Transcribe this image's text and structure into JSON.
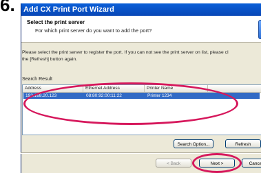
{
  "step_number": "6.",
  "window": {
    "title": "Add CX Print Port Wizard"
  },
  "header": {
    "title": "Select the print server",
    "subtitle": "For which print server do you want to add the port?"
  },
  "instruction": {
    "line1": "Please select the print server to register the port. If you can not see the print server on list, please cl",
    "line2": "the [Refresh] button again."
  },
  "search_result": {
    "label": "Search Result",
    "columns": [
      "Address",
      "Ethernet Address",
      "Printer Name"
    ],
    "rows": [
      {
        "address": "192.168.20.123",
        "ethernet": "08:80:92:00:11:22",
        "printer": "Printer 1234"
      }
    ]
  },
  "buttons": {
    "search_option": "Search Option...",
    "refresh": "Refresh",
    "back": "< Back",
    "next": "Next >",
    "cancel": "Cance"
  },
  "colors": {
    "title_bar": "#0a5fd8",
    "selection": "#316ac5",
    "highlight_ring": "#d6185c"
  }
}
